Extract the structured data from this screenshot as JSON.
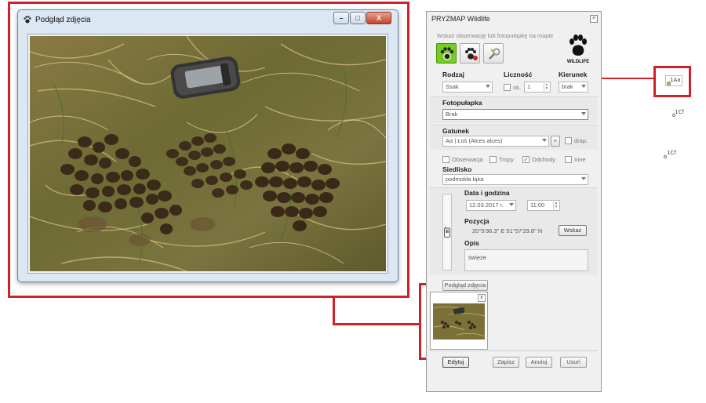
{
  "preview_window": {
    "title": "Podgląd zdjęcia"
  },
  "panel": {
    "title": "PRYZMAP Wildlife",
    "hint": "Wskaż obserwację lub fotopułapkę na mapie",
    "logo_text": "WILDLIFE",
    "headers": {
      "rodzaj": "Rodzaj",
      "licznosc": "Liczność",
      "kierunek": "Kierunek"
    },
    "rodzaj_value": "Ssak",
    "ok_label": "ok.",
    "count_value": "1",
    "kierunek_value": "brak",
    "fotopulapka_label": "Fotopułapka",
    "fotopulapka_value": "Brak",
    "gatunek_label": "Gatunek",
    "gatunek_value": "Aa | Łoś (Alces alces)",
    "plus_label": "+",
    "drap_label": "drap.",
    "types": [
      "Obserwacja",
      "Tropy",
      "Odchody",
      "Inne"
    ],
    "siedlisko_label": "Siedlisko",
    "siedlisko_value": "podmokła łąka",
    "data_label": "Data i godzina",
    "date_value": "12.03.2017 r.",
    "time_value": "11:00",
    "pozycja_label": "Pozycja",
    "position_value": "20°5'36.3\" E  51°57'29.8\" N",
    "wskaz_button": "Wskaż",
    "opis_label": "Opis",
    "opis_value": "świeże",
    "podglad_button": "Podgląd zdjęcia",
    "buttons": {
      "edytuj": "Edytuj",
      "zapisz": "Zapisz",
      "anuluj": "Anuluj",
      "usun": "Usuń"
    }
  },
  "thumbnail": {
    "close": "x"
  },
  "window_controls": {
    "minimize": "–",
    "maximize": "□",
    "close": "X"
  },
  "map_markers": [
    {
      "label": "1Aa"
    },
    {
      "label": "1Cf"
    },
    {
      "label": "1Cf"
    }
  ],
  "colors": {
    "annotation_red": "#d0202a",
    "active_tool_green": "#77cc22"
  }
}
